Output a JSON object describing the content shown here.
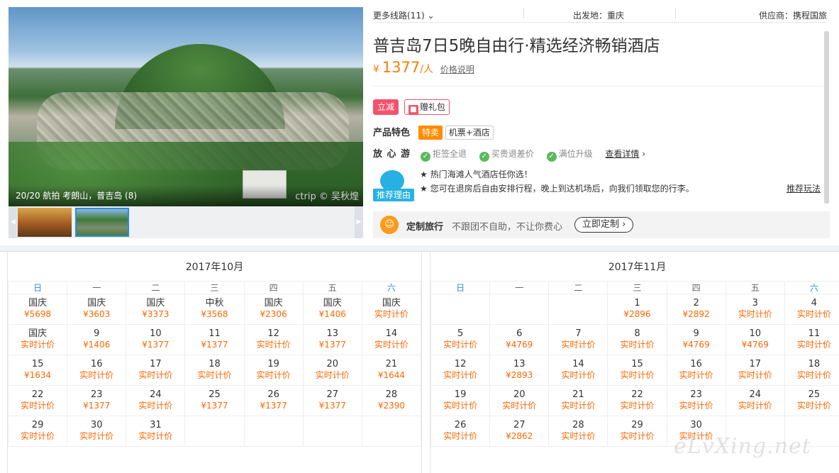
{
  "gallery": {
    "caption": "20/20 航拍 考朗山，普吉岛 (8)",
    "watermark": "ctrip © 吴秋煌",
    "prev": "◀",
    "next": "▶"
  },
  "header": {
    "more_routes": "更多线路(11)",
    "departure": "出发地：重庆",
    "supplier": "供应商：携程国旅"
  },
  "product": {
    "title": "普吉岛7日5晚自由行·精选经济畅销酒店",
    "price_currency": "¥",
    "price": "1377",
    "price_unit": "/人",
    "price_explain": "价格说明"
  },
  "promos": {
    "instant": "立减",
    "gift": "赠礼包"
  },
  "features": {
    "label": "产品特色",
    "chips": [
      "特卖",
      "机票+酒店"
    ]
  },
  "assurance": {
    "label": "放 心 游",
    "items": [
      "拒签全退",
      "买贵退差价",
      "满位升级"
    ],
    "detail": "查看详情"
  },
  "recommend": {
    "badge": "推荐理由",
    "lines": [
      "★ 热门海滩人气酒店任你选！",
      "★ 您可在退房后自由安排行程，晚上到达机场后，向我们领取您的行李。"
    ],
    "link": "推荐玩法"
  },
  "custom": {
    "label": "定制旅行",
    "text": "不跟团不自助，不让你费心",
    "button": "立即定制"
  },
  "weekdays": [
    "日",
    "一",
    "二",
    "三",
    "四",
    "五",
    "六"
  ],
  "calendars": [
    {
      "title": "2017年10月",
      "weeks": [
        [
          [
            "国庆",
            "¥5698"
          ],
          [
            "国庆",
            "¥3603"
          ],
          [
            "国庆",
            "¥3373"
          ],
          [
            "中秋",
            "¥3568"
          ],
          [
            "国庆",
            "¥2306"
          ],
          [
            "国庆",
            "¥1406"
          ],
          [
            "国庆",
            "实时计价"
          ]
        ],
        [
          [
            "国庆",
            "实时计价"
          ],
          [
            "9",
            "¥1406"
          ],
          [
            "10",
            "¥1377"
          ],
          [
            "11",
            "¥1377"
          ],
          [
            "12",
            "实时计价"
          ],
          [
            "13",
            "¥1377"
          ],
          [
            "14",
            "实时计价"
          ]
        ],
        [
          [
            "15",
            "¥1634"
          ],
          [
            "16",
            "实时计价"
          ],
          [
            "17",
            "实时计价"
          ],
          [
            "18",
            "实时计价"
          ],
          [
            "19",
            "实时计价"
          ],
          [
            "20",
            "实时计价"
          ],
          [
            "21",
            "¥1644"
          ]
        ],
        [
          [
            "22",
            "实时计价"
          ],
          [
            "23",
            "¥1377"
          ],
          [
            "24",
            "实时计价"
          ],
          [
            "25",
            "¥1377"
          ],
          [
            "26",
            "¥1377"
          ],
          [
            "27",
            "¥1377"
          ],
          [
            "28",
            "¥2390"
          ]
        ],
        [
          [
            "29",
            "实时计价"
          ],
          [
            "30",
            "实时计价"
          ],
          [
            "31",
            "实时计价"
          ],
          [
            "",
            ""
          ],
          [
            "",
            ""
          ],
          [
            "",
            ""
          ],
          [
            "",
            ""
          ]
        ]
      ]
    },
    {
      "title": "2017年11月",
      "weeks": [
        [
          [
            "",
            ""
          ],
          [
            "",
            ""
          ],
          [
            "",
            ""
          ],
          [
            "1",
            "¥2896"
          ],
          [
            "2",
            "¥2892"
          ],
          [
            "3",
            "实时计价"
          ],
          [
            "4",
            "实时计价"
          ]
        ],
        [
          [
            "5",
            "实时计价"
          ],
          [
            "6",
            "¥4769"
          ],
          [
            "7",
            "实时计价"
          ],
          [
            "8",
            "实时计价"
          ],
          [
            "9",
            "¥4769"
          ],
          [
            "10",
            "¥4769"
          ],
          [
            "11",
            "实时计价"
          ]
        ],
        [
          [
            "12",
            "实时计价"
          ],
          [
            "13",
            "¥2893"
          ],
          [
            "14",
            "实时计价"
          ],
          [
            "15",
            "实时计价"
          ],
          [
            "16",
            "实时计价"
          ],
          [
            "17",
            "实时计价"
          ],
          [
            "18",
            "实时计价"
          ]
        ],
        [
          [
            "19",
            "实时计价"
          ],
          [
            "20",
            "实时计价"
          ],
          [
            "21",
            "实时计价"
          ],
          [
            "22",
            "实时计价"
          ],
          [
            "23",
            "实时计价"
          ],
          [
            "24",
            "实时计价"
          ],
          [
            "25",
            "实时计价"
          ]
        ],
        [
          [
            "26",
            "实时计价"
          ],
          [
            "27",
            "¥2862"
          ],
          [
            "28",
            "实时计价"
          ],
          [
            "29",
            "实时计价"
          ],
          [
            "30",
            "实时计价"
          ],
          [
            "",
            ""
          ],
          [
            "",
            ""
          ]
        ]
      ]
    }
  ],
  "site_watermark": "eLvXing.net"
}
